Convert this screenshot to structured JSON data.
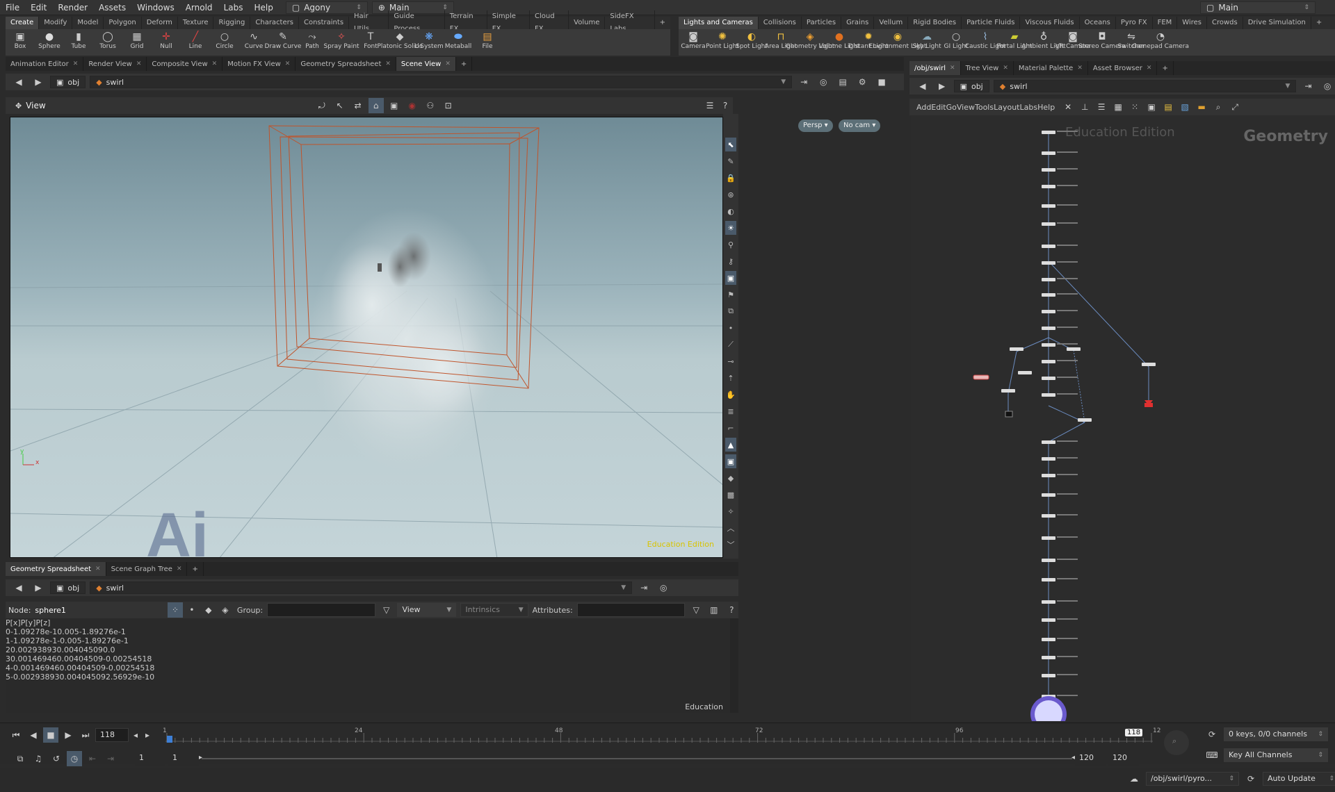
{
  "menubar": {
    "items": [
      "File",
      "Edit",
      "Render",
      "Assets",
      "Windows",
      "Arnold",
      "Labs",
      "Help"
    ],
    "desktop": "Agony",
    "workspace": "Main",
    "right_desktop": "Main"
  },
  "shelf_left": {
    "tabs": [
      "Create",
      "Modify",
      "Model",
      "Polygon",
      "Deform",
      "Texture",
      "Rigging",
      "Characters",
      "Constraints",
      "Hair Utils",
      "Guide Process",
      "Terrain FX",
      "Simple FX",
      "Cloud FX",
      "Volume",
      "SideFX Labs"
    ],
    "active_tab": 0,
    "tools": [
      {
        "label": "Box",
        "icon": "box-icon"
      },
      {
        "label": "Sphere",
        "icon": "sphere-icon"
      },
      {
        "label": "Tube",
        "icon": "tube-icon"
      },
      {
        "label": "Torus",
        "icon": "torus-icon"
      },
      {
        "label": "Grid",
        "icon": "grid-icon"
      },
      {
        "label": "Null",
        "icon": "null-icon"
      },
      {
        "label": "Line",
        "icon": "line-icon"
      },
      {
        "label": "Circle",
        "icon": "circle-icon"
      },
      {
        "label": "Curve",
        "icon": "curve-icon"
      },
      {
        "label": "Draw Curve",
        "icon": "draw-curve-icon"
      },
      {
        "label": "Path",
        "icon": "path-icon"
      },
      {
        "label": "Spray Paint",
        "icon": "spray-paint-icon"
      },
      {
        "label": "Font",
        "icon": "font-icon"
      },
      {
        "label": "Platonic Solids",
        "icon": "platonic-icon"
      },
      {
        "label": "L-System",
        "icon": "lsystem-icon"
      },
      {
        "label": "Metaball",
        "icon": "metaball-icon"
      },
      {
        "label": "File",
        "icon": "file-icon"
      }
    ]
  },
  "shelf_right": {
    "tabs": [
      "Lights and Cameras",
      "Collisions",
      "Particles",
      "Grains",
      "Vellum",
      "Rigid Bodies",
      "Particle Fluids",
      "Viscous Fluids",
      "Oceans",
      "Pyro FX",
      "FEM",
      "Wires",
      "Crowds",
      "Drive Simulation"
    ],
    "active_tab": 0,
    "tools": [
      {
        "label": "Camera",
        "icon": "camera-icon"
      },
      {
        "label": "Point Light",
        "icon": "point-light-icon"
      },
      {
        "label": "Spot Light",
        "icon": "spot-light-icon"
      },
      {
        "label": "Area Light",
        "icon": "area-light-icon"
      },
      {
        "label": "Geometry Light",
        "icon": "geometry-light-icon"
      },
      {
        "label": "Volume Light",
        "icon": "volume-light-icon"
      },
      {
        "label": "Distant Light",
        "icon": "distant-light-icon"
      },
      {
        "label": "Environment Light",
        "icon": "environment-light-icon"
      },
      {
        "label": "Sky Light",
        "icon": "sky-light-icon"
      },
      {
        "label": "GI Light",
        "icon": "gi-light-icon"
      },
      {
        "label": "Caustic Light",
        "icon": "caustic-light-icon"
      },
      {
        "label": "Portal Light",
        "icon": "portal-light-icon"
      },
      {
        "label": "Ambient Light",
        "icon": "ambient-light-icon"
      },
      {
        "label": "VR Camera",
        "icon": "vr-camera-icon"
      },
      {
        "label": "Stereo Camera",
        "icon": "stereo-camera-icon"
      },
      {
        "label": "Switcher",
        "icon": "switcher-icon"
      },
      {
        "label": "Gamepad Camera",
        "icon": "gamepad-camera-icon"
      }
    ]
  },
  "pane_tabs_top": [
    "Animation Editor",
    "Render View",
    "Composite View",
    "Motion FX View",
    "Geometry Spreadsheet",
    "Scene View"
  ],
  "pane_tabs_top_active": 5,
  "path": {
    "root": "obj",
    "node": "swirl"
  },
  "view": {
    "label": "View",
    "persp": "Persp",
    "cam": "No cam",
    "watermark": "Education Edition",
    "axis_x": "x",
    "axis_y": "y"
  },
  "pane_tabs_bottom": [
    "Geometry Spreadsheet",
    "Scene Graph Tree"
  ],
  "pane_tabs_bottom_active": 0,
  "spreadsheet": {
    "node_label": "Node:",
    "node_name": "sphere1",
    "group_label": "Group:",
    "view_label": "View",
    "intrinsics_label": "Intrinsics",
    "attributes_label": "Attributes:",
    "columns": [
      "",
      "P[x]",
      "P[y]",
      "P[z]"
    ],
    "rows": [
      [
        "0",
        "-1.09278e-1",
        "0.005",
        "-1.89276e-1"
      ],
      [
        "1",
        "-1.09278e-1",
        "-0.005",
        "-1.89276e-1"
      ],
      [
        "2",
        "0.00293893",
        "0.00404509",
        "0.0"
      ],
      [
        "3",
        "0.00146946",
        "0.00404509",
        "-0.00254518"
      ],
      [
        "4",
        "-0.00146946",
        "0.00404509",
        "-0.00254518"
      ],
      [
        "5",
        "-0.00293893",
        "0.00404509",
        "2.56929e-10"
      ]
    ],
    "watermark": "Education"
  },
  "network_tabs": [
    "/obj/swirl",
    "Tree View",
    "Material Palette",
    "Asset Browser"
  ],
  "network_tabs_active": 0,
  "network_menu": [
    "Add",
    "Edit",
    "Go",
    "View",
    "Tools",
    "Layout",
    "Labs",
    "Help"
  ],
  "network": {
    "watermark_left": "Education Edition",
    "watermark_right": "Geometry"
  },
  "timeline": {
    "current_frame": "118",
    "ticks": [
      "1",
      "24",
      "48",
      "72",
      "96",
      "12"
    ],
    "start": "1",
    "start2": "1",
    "end": "120",
    "end2": "120",
    "marker": "118"
  },
  "keys": {
    "status": "0 keys, 0/0 channels",
    "mode": "Key All Channels"
  },
  "status": {
    "path": "/obj/swirl/pyro...",
    "update": "Auto Update"
  },
  "colors": {
    "accent": "#4f6fa0",
    "node_selected": "#e03030",
    "watermark": "#d8c400"
  }
}
